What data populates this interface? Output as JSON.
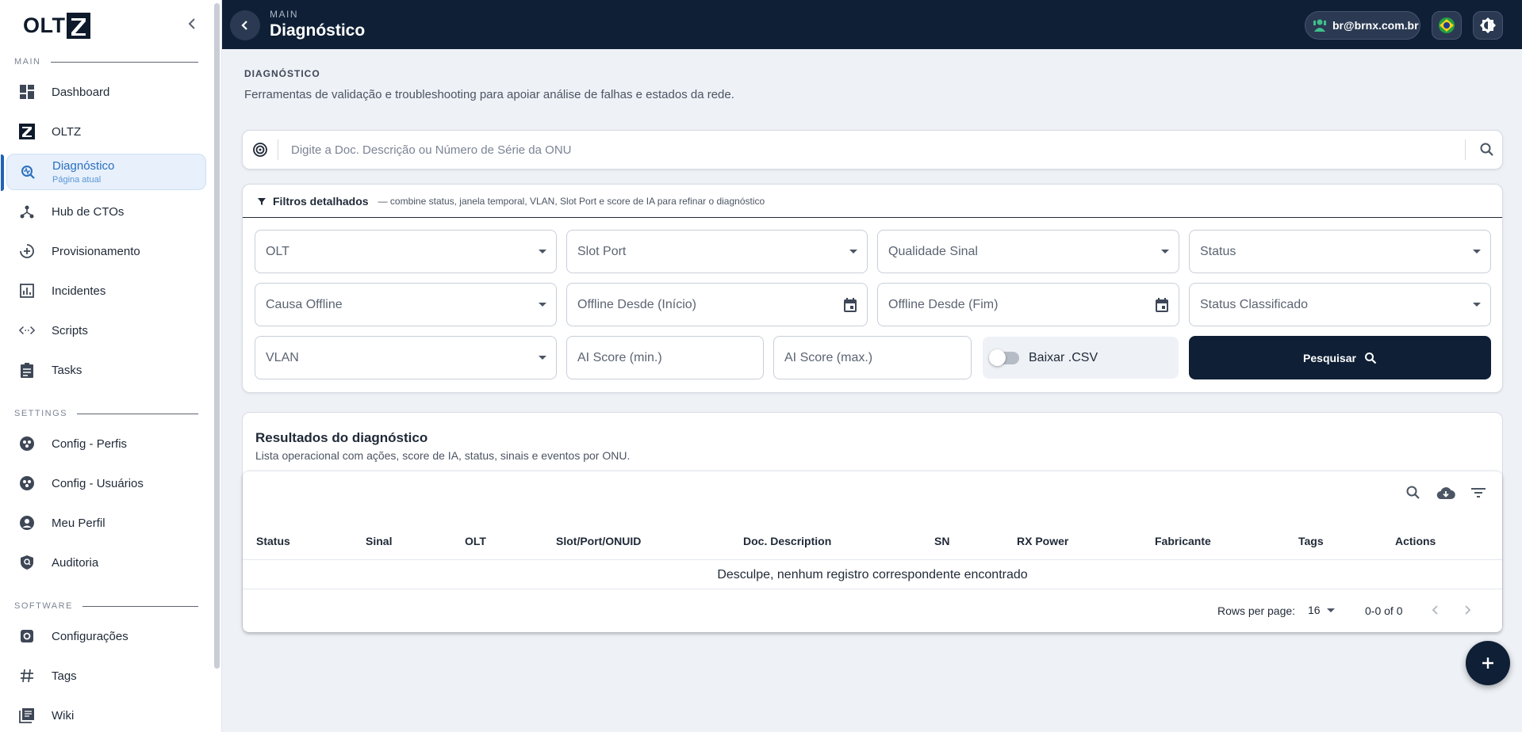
{
  "app": {
    "logo_text": "OLT"
  },
  "sidebar": {
    "sections": {
      "main": "MAIN",
      "settings": "SETTINGS",
      "software": "SOFTWARE"
    },
    "items": [
      {
        "label": "Dashboard",
        "icon": "dashboard-icon"
      },
      {
        "label": "OLTZ",
        "icon": "oltz-logo-icon"
      },
      {
        "label": "Diagnóstico",
        "sub": "Página atual",
        "icon": "diagnostic-search-icon",
        "active": true
      },
      {
        "label": "Hub de CTOs",
        "icon": "hub-icon"
      },
      {
        "label": "Provisionamento",
        "icon": "provision-icon"
      },
      {
        "label": "Incidentes",
        "icon": "incident-icon"
      },
      {
        "label": "Scripts",
        "icon": "code-icon"
      },
      {
        "label": "Tasks",
        "icon": "clipboard-icon"
      },
      {
        "label": "Config - Perfis",
        "icon": "profiles-icon"
      },
      {
        "label": "Config - Usuários",
        "icon": "users-icon"
      },
      {
        "label": "Meu Perfil",
        "icon": "account-icon"
      },
      {
        "label": "Auditoria",
        "icon": "shield-icon"
      },
      {
        "label": "Configurações",
        "icon": "settings-icon"
      },
      {
        "label": "Tags",
        "icon": "hash-icon"
      },
      {
        "label": "Wiki",
        "icon": "book-icon"
      }
    ]
  },
  "topbar": {
    "super": "MAIN",
    "title": "Diagnóstico",
    "user": "br@brnx.com.br"
  },
  "page": {
    "super": "DIAGNÓSTICO",
    "desc": "Ferramentas de validação e troubleshooting para apoiar análise de falhas e estados da rede."
  },
  "search": {
    "placeholder": "Digite a Doc. Descrição ou Número de Série da ONU"
  },
  "filters": {
    "title": "Filtros detalhados",
    "hint": "— combine status, janela temporal, VLAN, Slot Port e score de IA para refinar o diagnóstico",
    "olt": "OLT",
    "slot_port": "Slot Port",
    "qualidade": "Qualidade Sinal",
    "status": "Status",
    "causa": "Causa Offline",
    "offline_inicio": "Offline Desde (Início)",
    "offline_fim": "Offline Desde (Fim)",
    "status_class": "Status Classificado",
    "vlan": "VLAN",
    "ai_min": "AI Score (min.)",
    "ai_max": "AI Score (max.)",
    "csv": "Baixar .CSV",
    "search_btn": "Pesquisar"
  },
  "results": {
    "title": "Resultados do diagnóstico",
    "desc": "Lista operacional com ações, score de IA, status, sinais e eventos por ONU.",
    "columns": [
      "Status",
      "Sinal",
      "OLT",
      "Slot/Port/ONUID",
      "Doc. Description",
      "SN",
      "RX Power",
      "Fabricante",
      "Tags",
      "Actions"
    ],
    "empty": "Desculpe, nenhum registro correspondente encontrado",
    "rows_label": "Rows per page:",
    "rows_value": "16",
    "range": "0-0 of 0"
  },
  "colors": {
    "navy": "#0e1f36",
    "accent": "#2a6fc0",
    "active_bg": "#e7f0fb"
  }
}
